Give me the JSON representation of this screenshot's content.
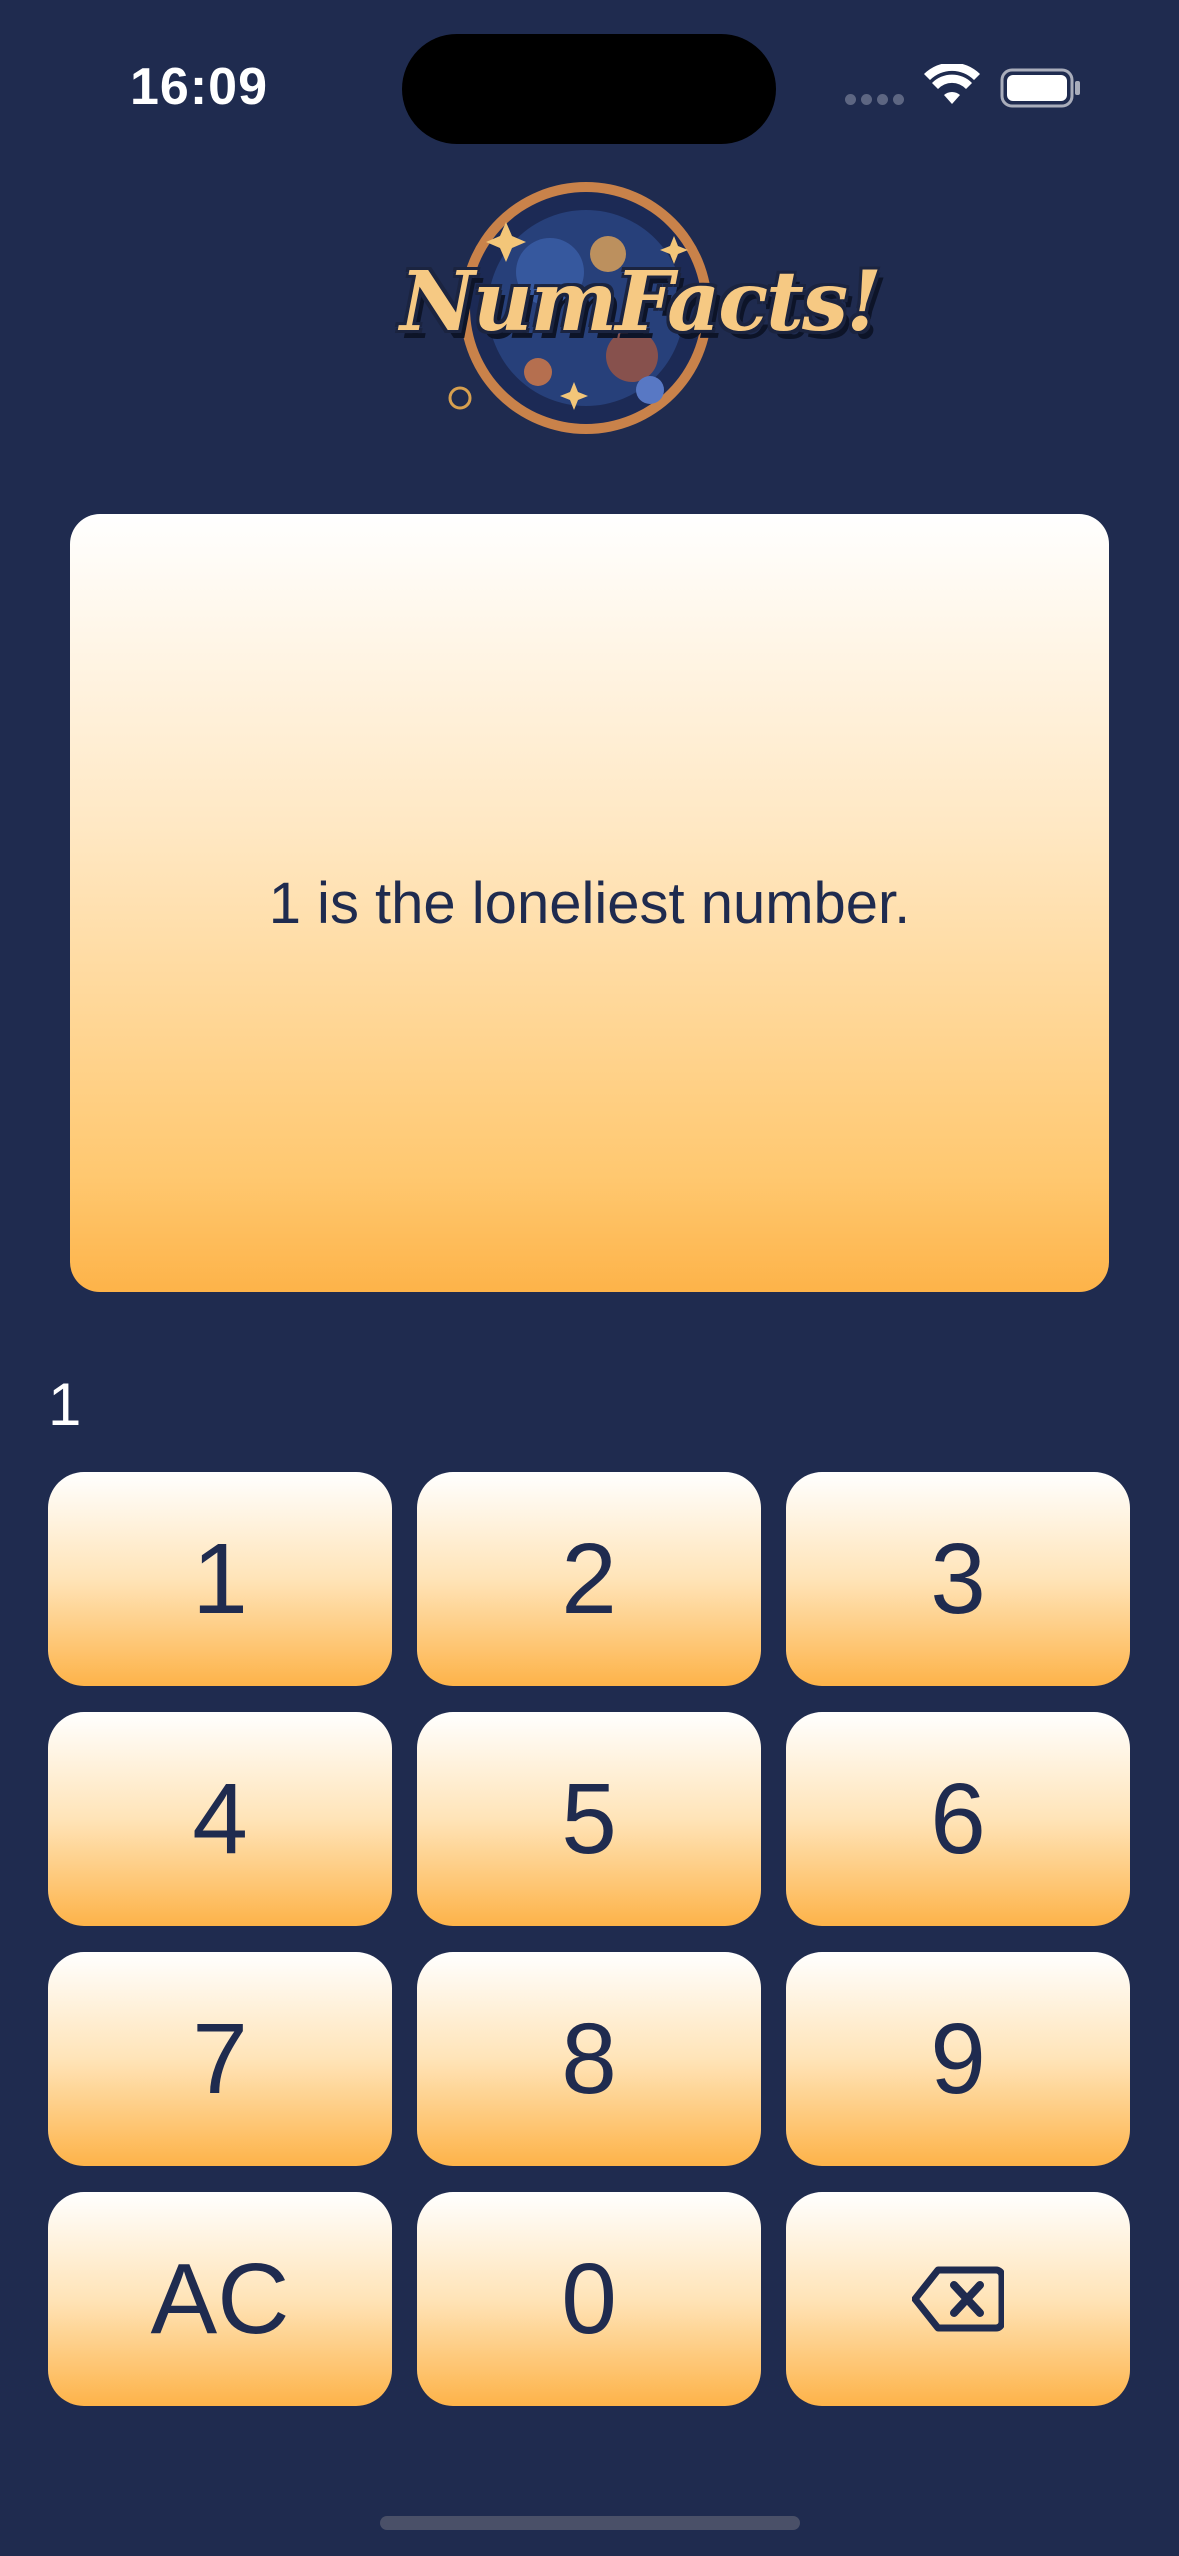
{
  "status_bar": {
    "time": "16:09"
  },
  "logo": {
    "text": "NumFacts!"
  },
  "fact": {
    "text": "1 is the loneliest number."
  },
  "current_input": "1",
  "keypad": {
    "keys": [
      "1",
      "2",
      "3",
      "4",
      "5",
      "6",
      "7",
      "8",
      "9",
      "AC",
      "0"
    ],
    "backspace_icon": "backspace-icon"
  },
  "colors": {
    "background": "#1f2b4f",
    "accent": "#fdb349",
    "text": "#1f2b4f"
  }
}
